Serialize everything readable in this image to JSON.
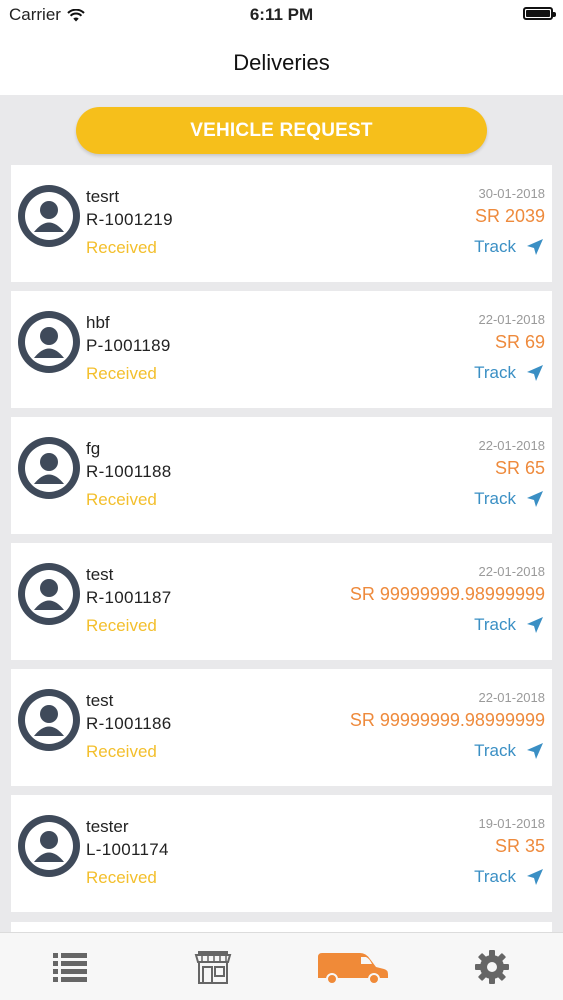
{
  "status_bar": {
    "carrier": "Carrier",
    "time": "6:11 PM"
  },
  "header": {
    "title": "Deliveries"
  },
  "actions": {
    "vehicle_request": "VEHICLE REQUEST"
  },
  "deliveries": [
    {
      "name": "tesrt",
      "order_id": "R-1001219",
      "status": "Received",
      "date": "30-01-2018",
      "amount": "SR 2039",
      "track_label": "Track"
    },
    {
      "name": "hbf",
      "order_id": "P-1001189",
      "status": "Received",
      "date": "22-01-2018",
      "amount": "SR 69",
      "track_label": "Track"
    },
    {
      "name": "fg",
      "order_id": "R-1001188",
      "status": "Received",
      "date": "22-01-2018",
      "amount": "SR 65",
      "track_label": "Track"
    },
    {
      "name": "test",
      "order_id": "R-1001187",
      "status": "Received",
      "date": "22-01-2018",
      "amount": "SR 99999999.98999999",
      "track_label": "Track"
    },
    {
      "name": "test",
      "order_id": "R-1001186",
      "status": "Received",
      "date": "22-01-2018",
      "amount": "SR 99999999.98999999",
      "track_label": "Track"
    },
    {
      "name": "tester",
      "order_id": "L-1001174",
      "status": "Received",
      "date": "19-01-2018",
      "amount": "SR 35",
      "track_label": "Track"
    }
  ],
  "tab_bar": {
    "tabs": [
      {
        "icon": "list-icon",
        "active": false
      },
      {
        "icon": "store-icon",
        "active": false
      },
      {
        "icon": "van-icon",
        "active": true
      },
      {
        "icon": "gear-icon",
        "active": false
      }
    ]
  },
  "colors": {
    "accent_yellow": "#f6bf1b",
    "amount_orange": "#ee8a3c",
    "track_blue": "#3a8fc4",
    "status_yellow": "#f3bf2c",
    "avatar_dark": "#3f4a5a",
    "tab_inactive": "#666666",
    "tab_active": "#f08a38"
  }
}
